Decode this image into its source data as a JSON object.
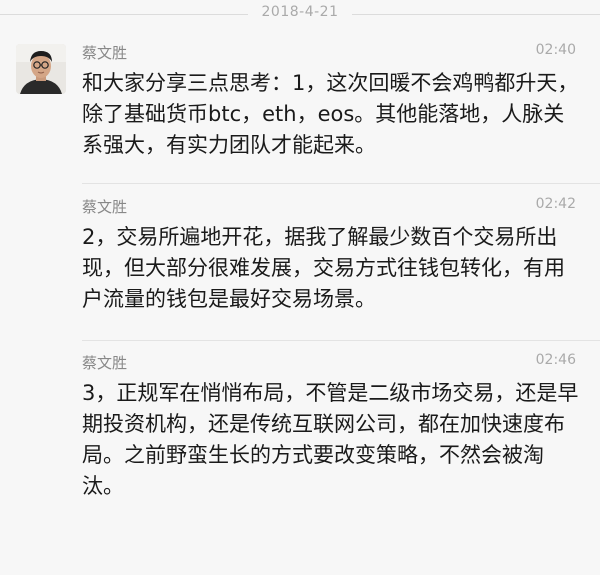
{
  "date_separator": "2018-4-21",
  "messages": [
    {
      "sender": "蔡文胜",
      "time": "02:40",
      "text": "和大家分享三点思考：1，这次回暖不会鸡鸭都升天，除了基础货币btc，eth，eos。其他能落地，人脉关系强大，有实力团队才能起来。",
      "has_avatar": true
    },
    {
      "sender": "蔡文胜",
      "time": "02:42",
      "text": "2，交易所遍地开花，据我了解最少数百个交易所出现，但大部分很难发展，交易方式往钱包转化，有用户流量的钱包是最好交易场景。",
      "has_avatar": false
    },
    {
      "sender": "蔡文胜",
      "time": "02:46",
      "text": "3，正规军在悄悄布局，不管是二级市场交易，还是早期投资机构，还是传统互联网公司，都在加快速度布局。之前野蛮生长的方式要改变策略，不然会被淘汰。",
      "has_avatar": false
    }
  ],
  "colors": {
    "background": "#f7f7f7",
    "sender": "#888888",
    "time": "#aaaaaa",
    "text": "#1a1a1a",
    "divider": "#e3e3e3"
  }
}
